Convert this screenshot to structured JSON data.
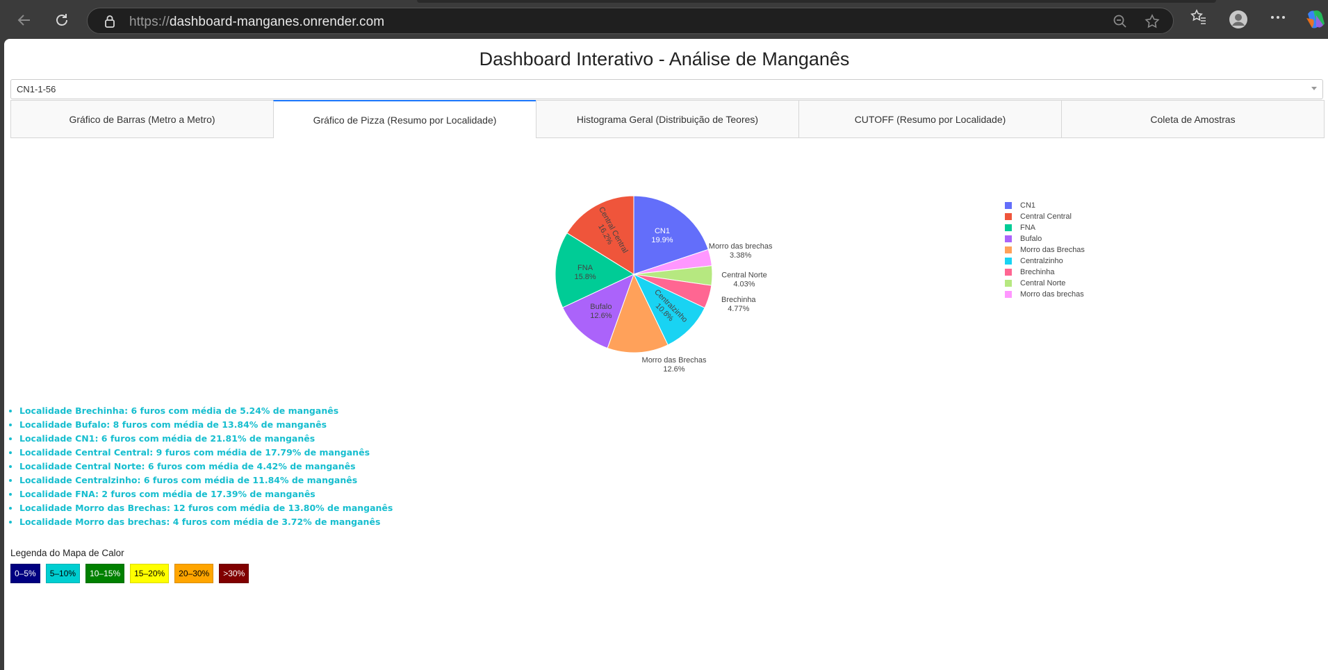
{
  "browser": {
    "url_scheme": "https://",
    "url_host": "dashboard-manganes.onrender.com"
  },
  "page": {
    "title": "Dashboard Interativo - Análise de Manganês",
    "dropdown_value": "CN1-1-56",
    "tabs": [
      {
        "label": "Gráfico de Barras (Metro a Metro)",
        "active": false
      },
      {
        "label": "Gráfico de Pizza (Resumo por Localidade)",
        "active": true
      },
      {
        "label": "Histograma Geral (Distribuição de Teores)",
        "active": false
      },
      {
        "label": "CUTOFF (Resumo por Localidade)",
        "active": false
      },
      {
        "label": "Coleta de Amostras",
        "active": false
      }
    ]
  },
  "chart_data": {
    "type": "pie",
    "slices": [
      {
        "label": "CN1",
        "percent": 19.9,
        "percent_text": "19.9%",
        "color": "#636efa"
      },
      {
        "label": "Morro das brechas",
        "percent": 3.38,
        "percent_text": "3.38%",
        "color": "#ff97ff"
      },
      {
        "label": "Central Norte",
        "percent": 4.03,
        "percent_text": "4.03%",
        "color": "#b6e880"
      },
      {
        "label": "Brechinha",
        "percent": 4.77,
        "percent_text": "4.77%",
        "color": "#ff6692"
      },
      {
        "label": "Centralzinho",
        "percent": 10.8,
        "percent_text": "10.8%",
        "color": "#19d3f3"
      },
      {
        "label": "Morro das Brechas",
        "percent": 12.6,
        "percent_text": "12.6%",
        "color": "#ffa15a"
      },
      {
        "label": "Bufalo",
        "percent": 12.6,
        "percent_text": "12.6%",
        "color": "#ab63fa"
      },
      {
        "label": "FNA",
        "percent": 15.8,
        "percent_text": "15.8%",
        "color": "#00cc96"
      },
      {
        "label": "Central Central",
        "percent": 16.2,
        "percent_text": "16.2%",
        "color": "#ef553b"
      }
    ],
    "legend": [
      {
        "label": "CN1",
        "color": "#636efa"
      },
      {
        "label": "Central Central",
        "color": "#ef553b"
      },
      {
        "label": "FNA",
        "color": "#00cc96"
      },
      {
        "label": "Bufalo",
        "color": "#ab63fa"
      },
      {
        "label": "Morro das Brechas",
        "color": "#ffa15a"
      },
      {
        "label": "Centralzinho",
        "color": "#19d3f3"
      },
      {
        "label": "Brechinha",
        "color": "#ff6692"
      },
      {
        "label": "Central Norte",
        "color": "#b6e880"
      },
      {
        "label": "Morro das brechas",
        "color": "#ff97ff"
      }
    ],
    "legend_position": "right"
  },
  "summary": [
    "Localidade Brechinha: 6 furos com média de 5.24% de manganês",
    "Localidade Bufalo: 8 furos com média de 13.84% de manganês",
    "Localidade CN1: 6 furos com média de 21.81% de manganês",
    "Localidade Central Central: 9 furos com média de 17.79% de manganês",
    "Localidade Central Norte: 6 furos com média de 4.42% de manganês",
    "Localidade Centralzinho: 6 furos com média de 11.84% de manganês",
    "Localidade FNA: 2 furos com média de 17.39% de manganês",
    "Localidade Morro das Brechas: 12 furos com média de 13.80% de manganês",
    "Localidade Morro das brechas: 4 furos com média de 3.72% de manganês"
  ],
  "heatmap_legend": {
    "title": "Legenda do Mapa de Calor",
    "items": [
      {
        "label": "0–5%",
        "bg": "#000080",
        "fg": "#ffffff"
      },
      {
        "label": "5–10%",
        "bg": "#00ced1",
        "fg": "#000000"
      },
      {
        "label": "10–15%",
        "bg": "#008000",
        "fg": "#ffffff"
      },
      {
        "label": "15–20%",
        "bg": "#ffff00",
        "fg": "#000000"
      },
      {
        "label": "20–30%",
        "bg": "#ffa500",
        "fg": "#000000"
      },
      {
        "label": ">30%",
        "bg": "#800000",
        "fg": "#ffffff"
      }
    ]
  },
  "icons": [
    "back-icon",
    "reload-icon",
    "lock-icon",
    "zoom-out-icon",
    "star-icon",
    "favorites-icon",
    "profile-icon",
    "more-icon",
    "copilot-icon"
  ]
}
